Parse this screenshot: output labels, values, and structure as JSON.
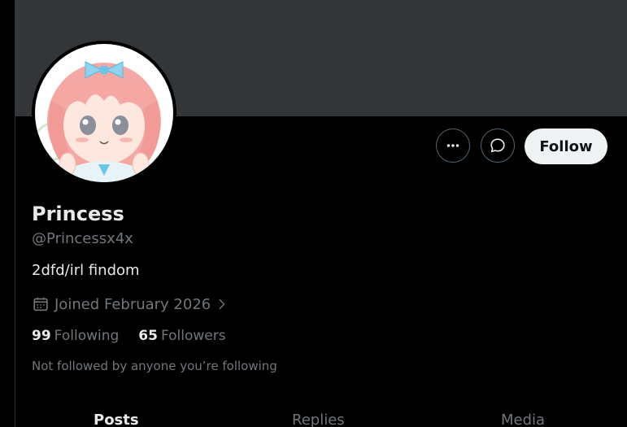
{
  "profile": {
    "display_name": "Princess",
    "handle": "@Princessx4x",
    "bio": "2dfd/irl findom",
    "joined": "Joined February 2026",
    "following_count": "99",
    "following_label": "Following",
    "followers_count": "65",
    "followers_label": "Followers",
    "not_followed_note": "Not followed by anyone you’re following"
  },
  "actions": {
    "more_icon": "more-horizontal-icon",
    "message_icon": "message-bubble-icon",
    "follow_label": "Follow"
  },
  "icons": {
    "joined": "calendar-icon",
    "joined_chevron": "chevron-right-icon"
  },
  "tabs": [
    {
      "label": "Posts",
      "selected": true
    },
    {
      "label": "Replies",
      "selected": false
    },
    {
      "label": "Media",
      "selected": false
    }
  ],
  "colors": {
    "background": "#000000",
    "banner": "#333639",
    "primary_text": "#e7e9ea",
    "secondary_text": "#71767b",
    "follow_button_bg": "#eff3f4"
  }
}
